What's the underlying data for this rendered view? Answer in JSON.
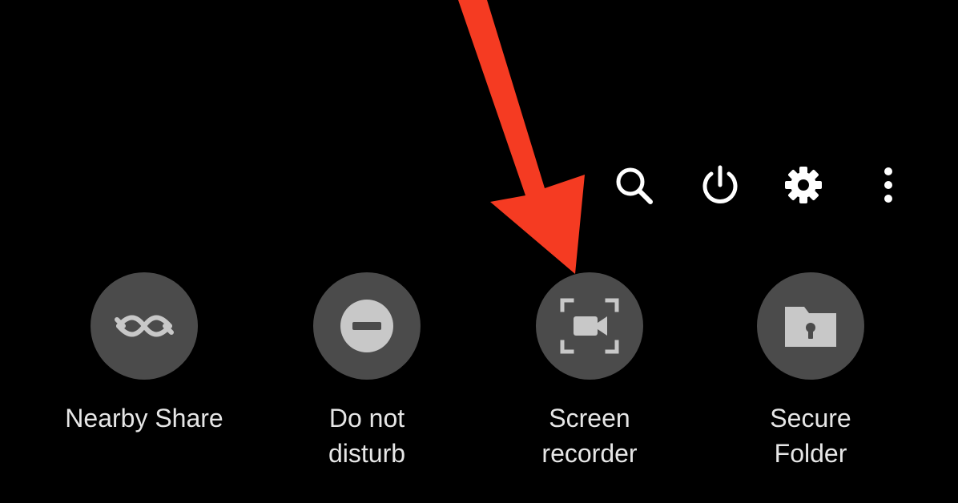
{
  "header": {
    "icons": [
      "search-icon",
      "power-icon",
      "gear-icon",
      "more-vert-icon"
    ]
  },
  "tiles": [
    {
      "icon": "nearby-share-icon",
      "label": "Nearby Share"
    },
    {
      "icon": "do-not-disturb-icon",
      "label": "Do not\ndisturb"
    },
    {
      "icon": "screen-recorder-icon",
      "label": "Screen\nrecorder"
    },
    {
      "icon": "secure-folder-icon",
      "label": "Secure\nFolder"
    }
  ],
  "colors": {
    "background": "#000000",
    "tile_circle": "#4b4b4b",
    "icon_fill": "#c8c8c8",
    "label": "#e6e6e6",
    "annotation_arrow": "#f53b22"
  }
}
